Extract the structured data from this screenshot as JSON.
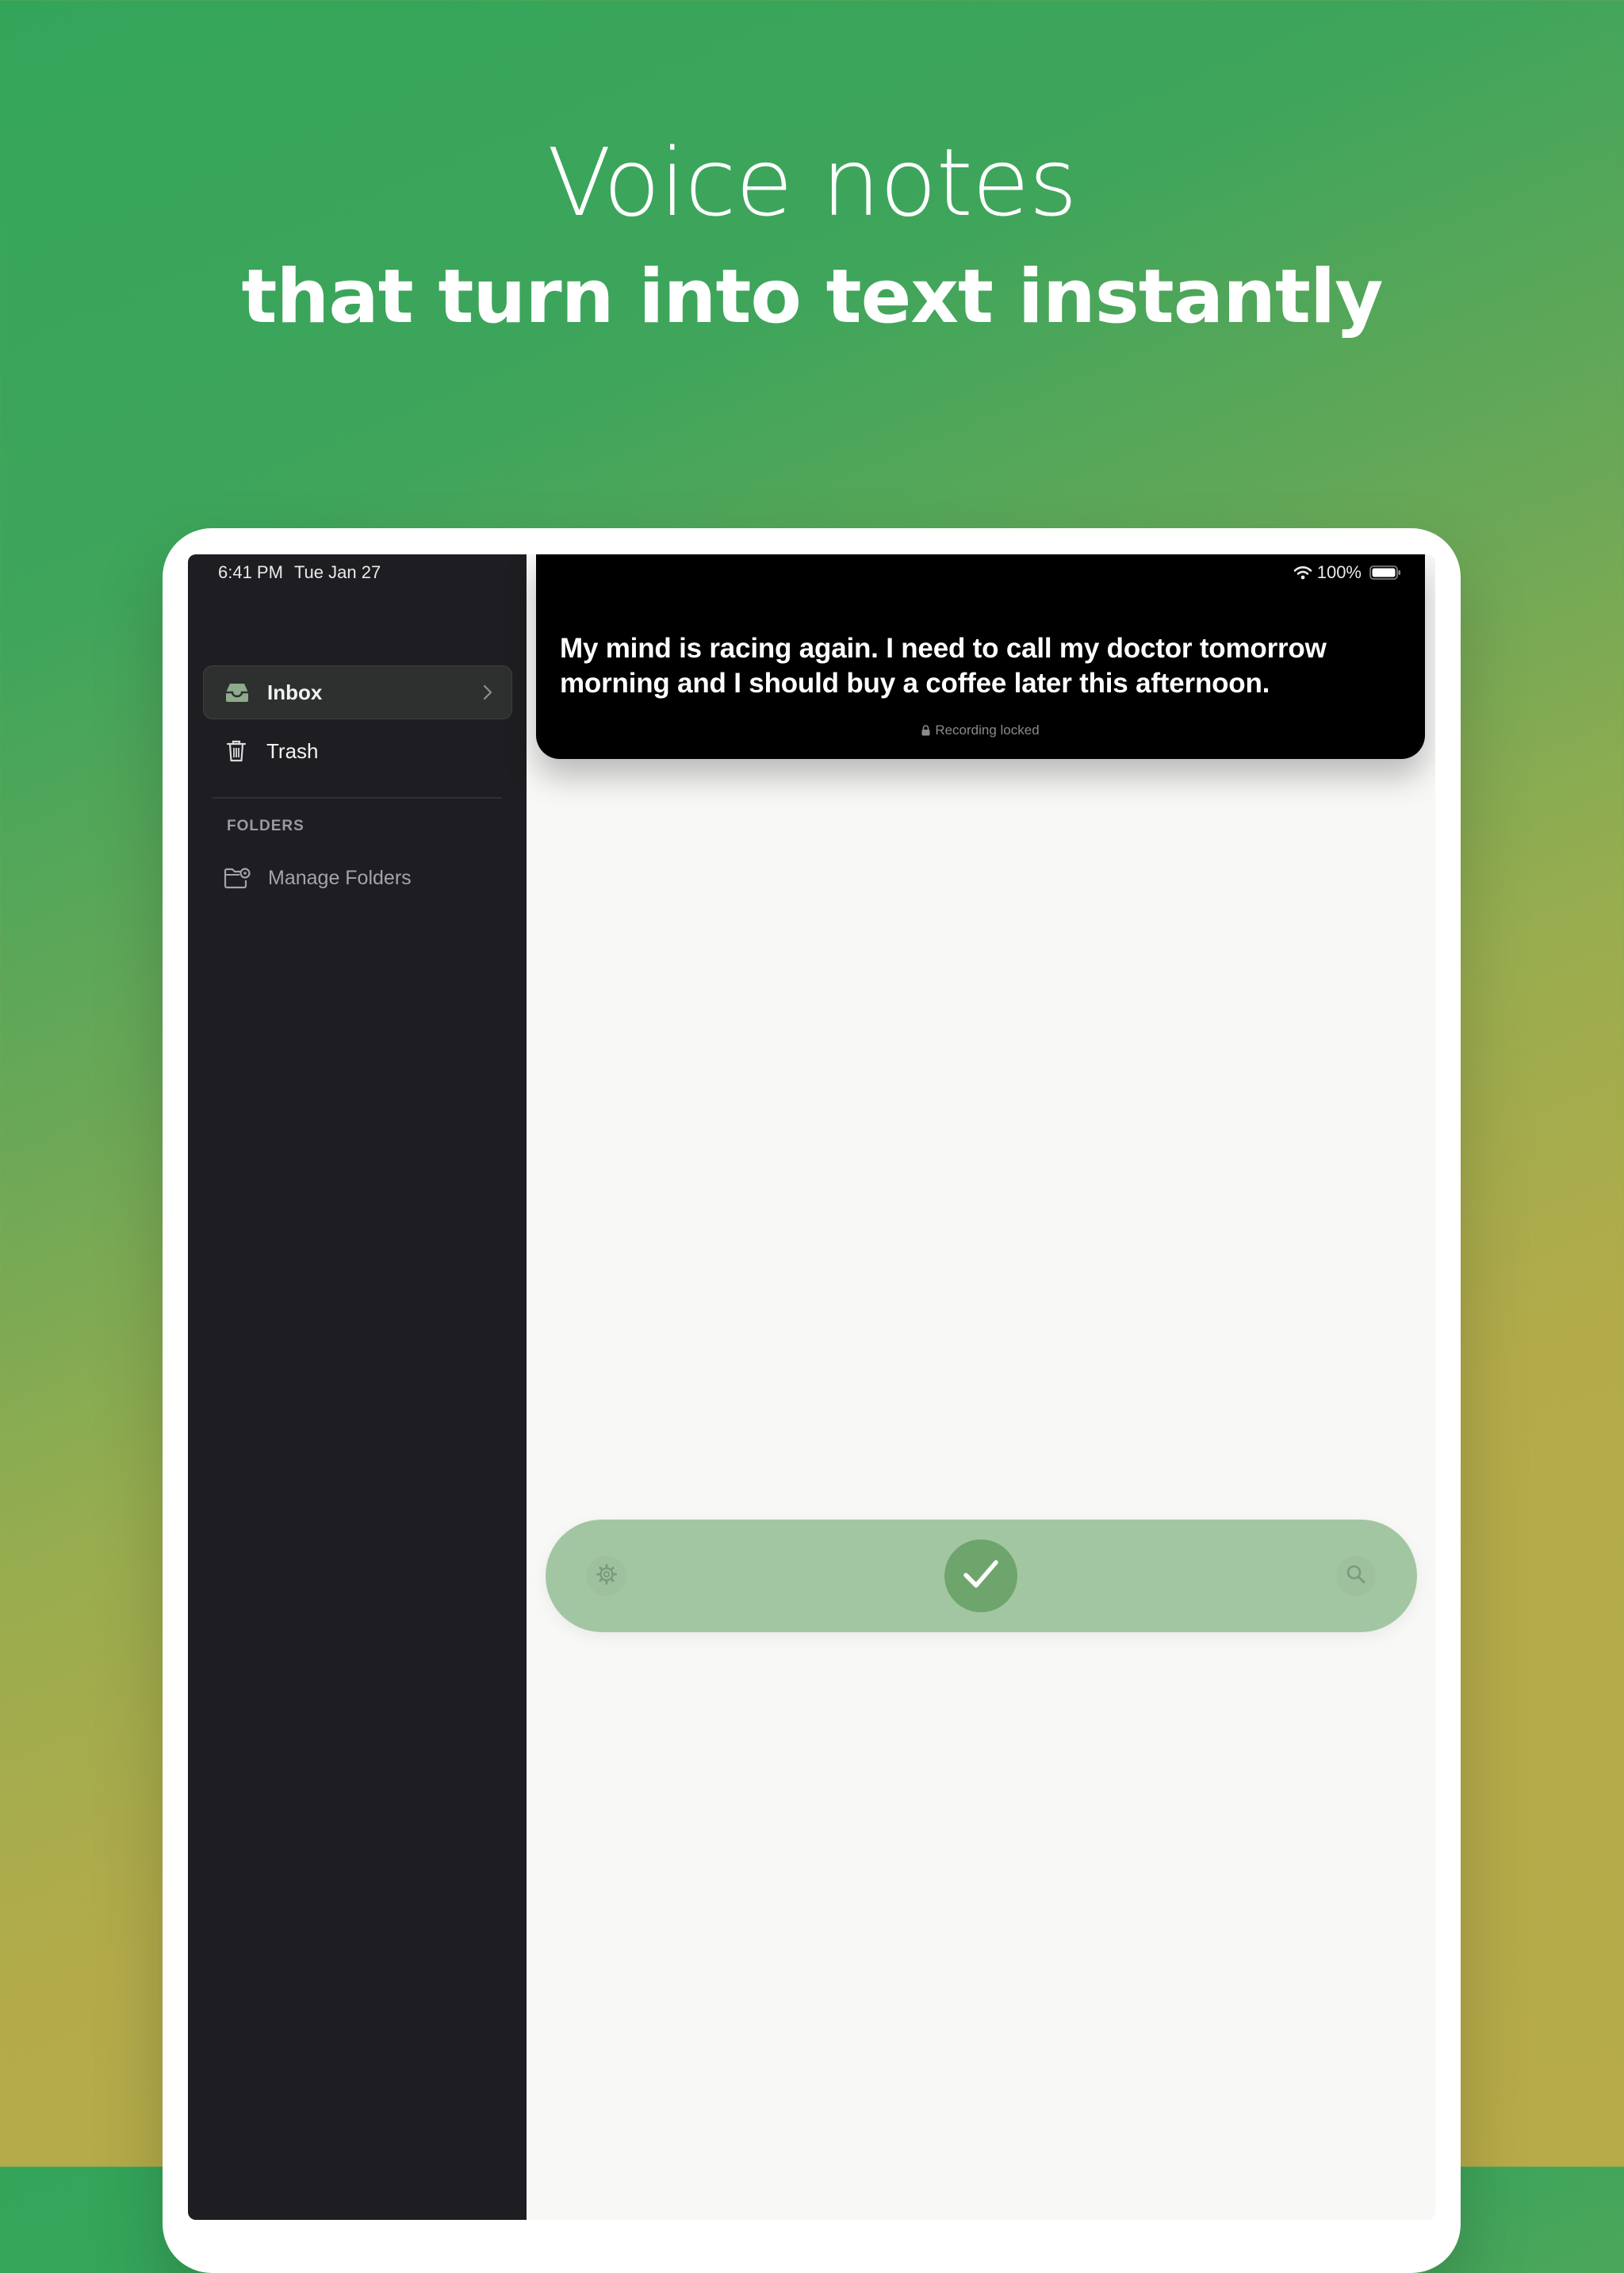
{
  "headline": {
    "line1": "Voice notes",
    "line2": "that turn into text instantly"
  },
  "status_bar": {
    "time": "6:41 PM",
    "date": "Tue Jan 27",
    "battery": "100%",
    "icons": [
      "wifi-icon",
      "battery-icon"
    ]
  },
  "sidebar": {
    "items": [
      {
        "label": "Inbox",
        "icon": "inbox-tray-icon",
        "selected": true
      },
      {
        "label": "Trash",
        "icon": "trash-icon",
        "selected": false
      }
    ],
    "folders_heading": "FOLDERS",
    "manage_folders": {
      "label": "Manage Folders",
      "icon": "folder-settings-icon"
    }
  },
  "transcript": {
    "text": "My mind is racing again. I need to call my doctor tomorrow morning and I should buy a coffee later this afternoon.",
    "status": "Recording locked",
    "status_icon": "lock-icon"
  },
  "bottom_bar": {
    "left_icon": "settings-gear-icon",
    "center_icon": "checkmark-icon",
    "right_icon": "search-icon"
  },
  "colors": {
    "sidebar_bg": "#1e1e22",
    "content_bg": "#f8f8f7",
    "bar_bg": "#a3c6a2",
    "confirm_button": "#6ea56d",
    "gradient_top": "#33a55a",
    "gradient_bottom": "#b7ab49"
  }
}
